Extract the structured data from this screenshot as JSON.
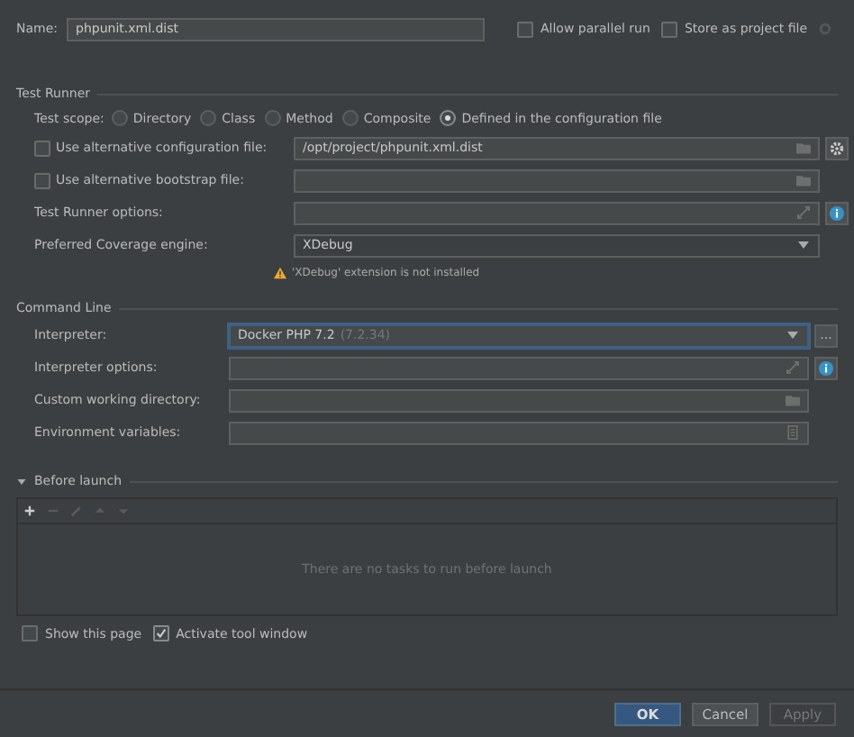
{
  "name_row": {
    "label": "Name:",
    "value": "phpunit.xml.dist",
    "options": [
      {
        "label": "Allow parallel run",
        "checked": false
      },
      {
        "label": "Store as project file",
        "checked": false
      }
    ]
  },
  "test_runner": {
    "title": "Test Runner",
    "scope": {
      "label": "Test scope:",
      "options": [
        {
          "label": "Directory",
          "selected": false
        },
        {
          "label": "Class",
          "selected": false
        },
        {
          "label": "Method",
          "selected": false
        },
        {
          "label": "Composite",
          "selected": false
        },
        {
          "label": "Defined in the configuration file",
          "selected": true
        }
      ]
    },
    "fields": [
      {
        "kind": "path",
        "label": "Use alternative configuration file:",
        "checked": false,
        "value": "/opt/project/phpunit.xml.dist",
        "side": {
          "kind": "settings"
        }
      },
      {
        "kind": "path",
        "label": "Use alternative bootstrap file:",
        "checked": false
      },
      {
        "kind": "expand",
        "label": "Test Runner options:",
        "side": {
          "kind": "info"
        }
      },
      {
        "kind": "select",
        "label": "Preferred Coverage engine:",
        "value": "XDebug"
      }
    ],
    "warning": "'XDebug' extension is not installed"
  },
  "command_line": {
    "title": "Command Line",
    "fields": [
      {
        "kind": "select",
        "label": "Interpreter:",
        "value": "Docker PHP 7.2",
        "version": "(7.2.34)",
        "focused": true,
        "side": {
          "kind": "browse",
          "label": "..."
        }
      },
      {
        "kind": "expand",
        "label": "Interpreter options:",
        "side": {
          "kind": "info"
        }
      },
      {
        "kind": "path",
        "label": "Custom working directory:"
      },
      {
        "kind": "env",
        "label": "Environment variables:"
      }
    ]
  },
  "before_launch": {
    "title": "Before launch",
    "expanded": true,
    "empty_text": "There are no tasks to run before launch"
  },
  "footer_options": [
    {
      "label": "Show this page",
      "checked": false
    },
    {
      "label": "Activate tool window",
      "checked": true
    }
  ],
  "buttons": [
    {
      "label": "OK",
      "kind": "primary"
    },
    {
      "label": "Cancel",
      "kind": "normal"
    },
    {
      "label": "Apply",
      "kind": "disabled"
    }
  ]
}
